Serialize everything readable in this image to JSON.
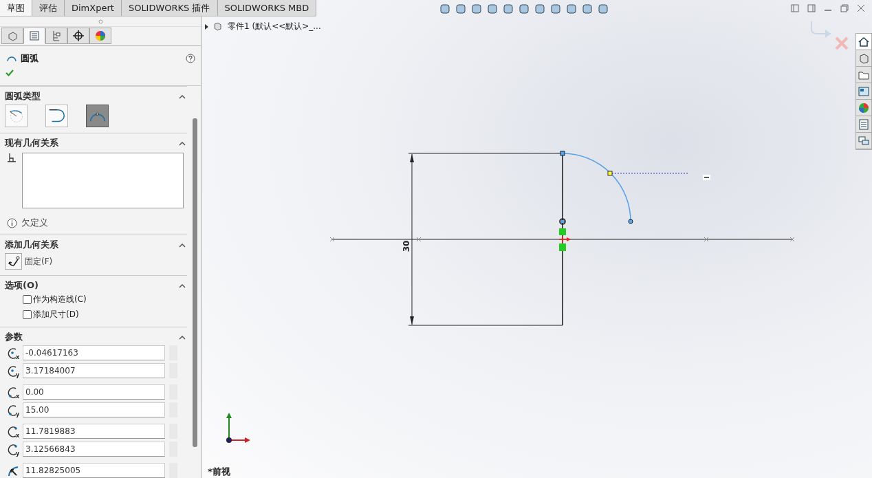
{
  "command_tabs": [
    {
      "label": "草图",
      "selected": true
    },
    {
      "label": "评估",
      "selected": false
    },
    {
      "label": "DimXpert",
      "selected": false
    },
    {
      "label": "SOLIDWORKS 插件",
      "selected": false
    },
    {
      "label": "SOLIDWORKS MBD",
      "selected": false
    }
  ],
  "panel_tabs": [
    {
      "kind": "feature-tree",
      "selected": false
    },
    {
      "kind": "property",
      "selected": true
    },
    {
      "kind": "configuration",
      "selected": false
    },
    {
      "kind": "dimxpert",
      "selected": false
    },
    {
      "kind": "display",
      "selected": false
    }
  ],
  "property_manager": {
    "title": "圆弧",
    "arc_type": {
      "title": "圆弧类型",
      "options": [
        {
          "kind": "centerpoint",
          "selected": false
        },
        {
          "kind": "tangent",
          "selected": false
        },
        {
          "kind": "three-point",
          "selected": true
        }
      ]
    },
    "existing_relations": {
      "title": "现有几何关系",
      "status": "欠定义"
    },
    "add_relations": {
      "title": "添加几何关系",
      "items": [
        {
          "label": "固定(F)"
        }
      ]
    },
    "options": {
      "title": "选项(O)",
      "checkboxes": [
        {
          "label": "作为构造线(C)",
          "checked": false
        },
        {
          "label": "添加尺寸(D)",
          "checked": false
        }
      ]
    },
    "parameters": {
      "title": "参数",
      "groups": [
        {
          "kind": "center",
          "fields": [
            {
              "axis": "x",
              "value": "-0.04617163"
            },
            {
              "axis": "y",
              "value": "3.17184007"
            }
          ]
        },
        {
          "kind": "start",
          "fields": [
            {
              "axis": "x",
              "value": "0.00"
            },
            {
              "axis": "y",
              "value": "15.00"
            }
          ]
        },
        {
          "kind": "end",
          "fields": [
            {
              "axis": "x",
              "value": "11.7819883"
            },
            {
              "axis": "y",
              "value": "3.12566843"
            }
          ]
        },
        {
          "kind": "radius",
          "fields": [
            {
              "value": "11.82825005"
            }
          ]
        }
      ]
    }
  },
  "feature_tree": {
    "expanded": false,
    "label": "零件1  (默认<<默认>_..."
  },
  "graphics": {
    "dimension": "30",
    "view_name": "*前视"
  },
  "task_pane": [
    {
      "kind": "home",
      "selected": true
    },
    {
      "kind": "parts",
      "selected": false
    },
    {
      "kind": "folder",
      "selected": false
    },
    {
      "kind": "view-palette",
      "selected": false
    },
    {
      "kind": "appearances",
      "selected": false
    },
    {
      "kind": "properties",
      "selected": false
    },
    {
      "kind": "forum",
      "selected": false
    }
  ]
}
